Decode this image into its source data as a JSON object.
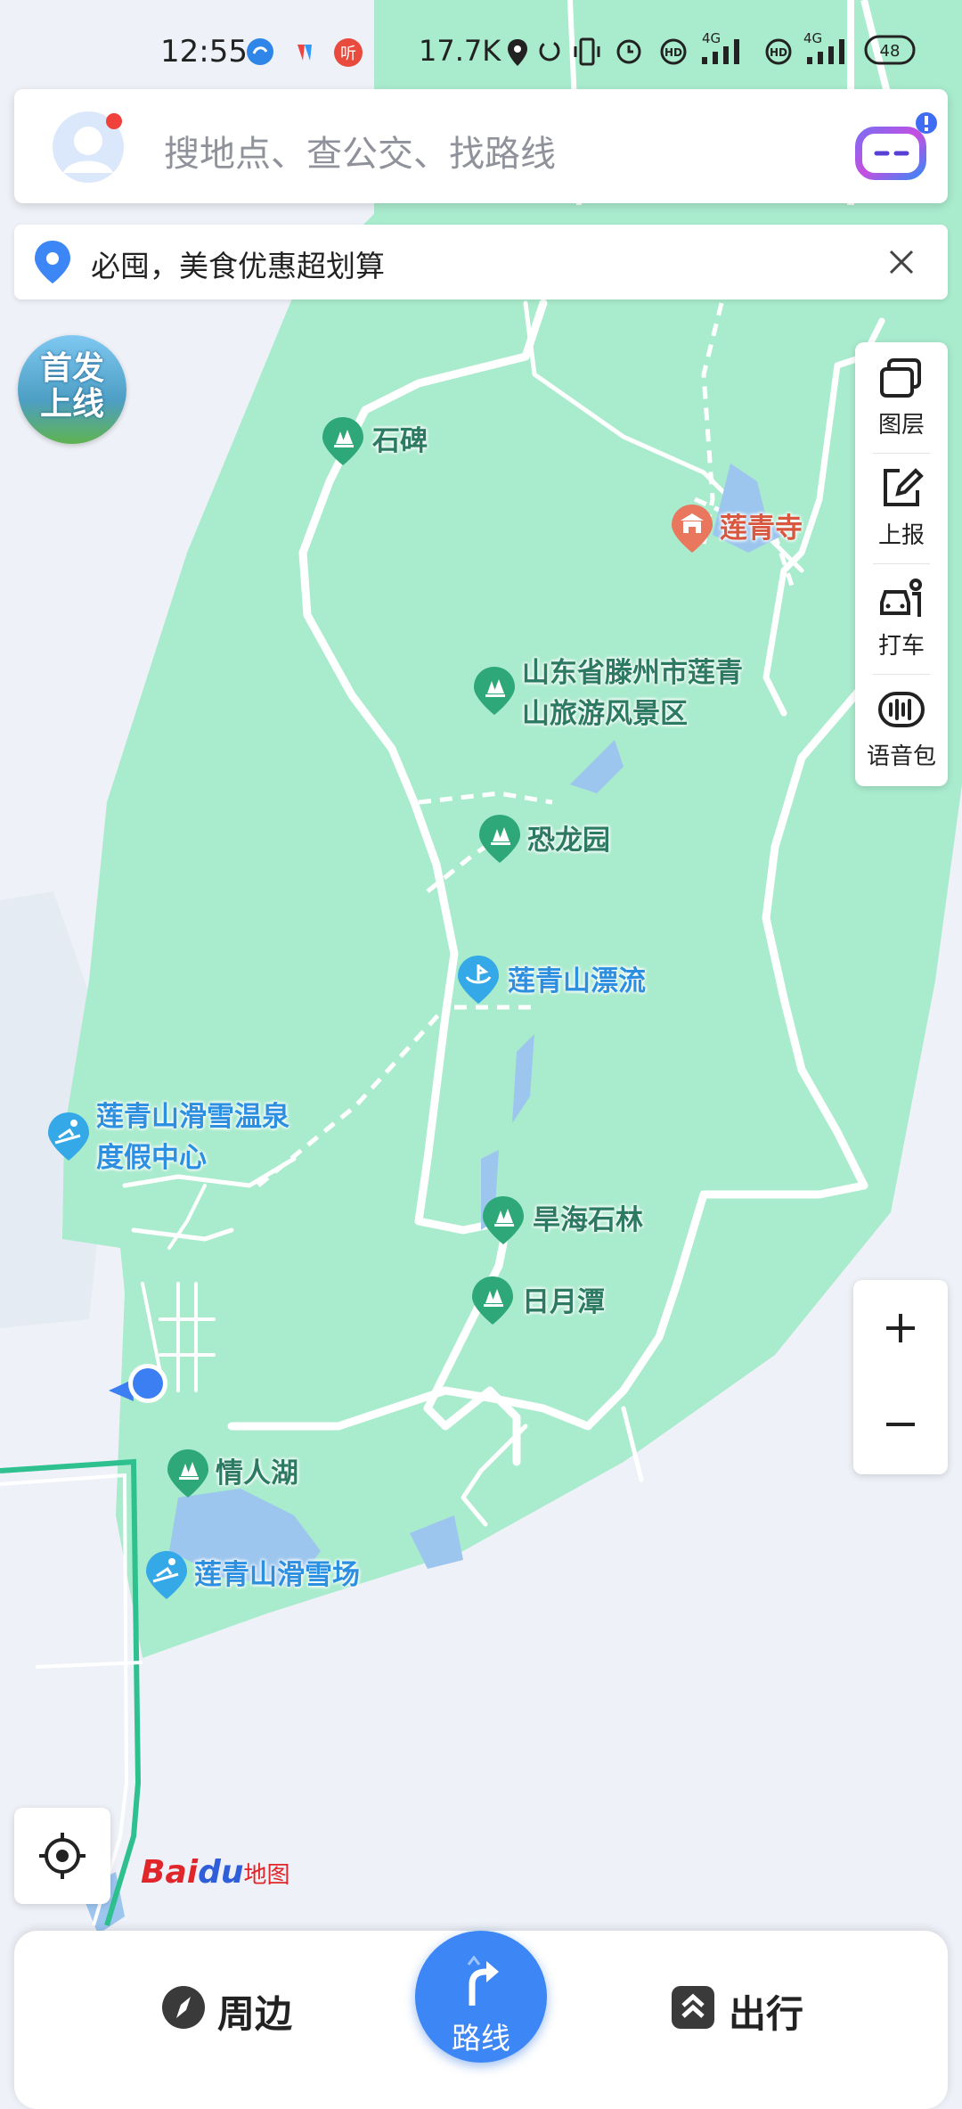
{
  "status_bar": {
    "time": "12:55",
    "net_speed": "17.7K",
    "signal_1": "4G",
    "signal_2": "4G",
    "battery": "48"
  },
  "search": {
    "placeholder": "搜地点、查公交、找路线"
  },
  "promo": {
    "text": "必囤，美食优惠超划算"
  },
  "badge": {
    "line1": "首发",
    "line2": "上线"
  },
  "toolbar": {
    "layers": "图层",
    "report": "上报",
    "taxi": "打车",
    "voice": "语音包"
  },
  "pois": {
    "shibei": "石碑",
    "lianqingsi": "莲青寺",
    "scenic": "山东省滕州市莲青山旅游风景区",
    "konglong": "恐龙园",
    "piaoliu": "莲青山漂流",
    "resort": "莲青山滑雪温泉度假中心",
    "hanhai": "旱海石林",
    "riyuetan": "日月潭",
    "qingrenhu": "情人湖",
    "skifield": "莲青山滑雪场"
  },
  "zoom": {
    "plus": "+",
    "minus": "−"
  },
  "logo": {
    "bai": "Bai",
    "du": "du",
    "map": "地图"
  },
  "bottom": {
    "nearby": "周边",
    "route": "路线",
    "travel": "出行"
  },
  "colors": {
    "park_green": "#a9ebcd",
    "poi_green": "#2ea879",
    "poi_blue": "#35a8e8",
    "poi_red": "#e8775e",
    "route_blue": "#3c86f5",
    "water": "#9dc6ef"
  }
}
